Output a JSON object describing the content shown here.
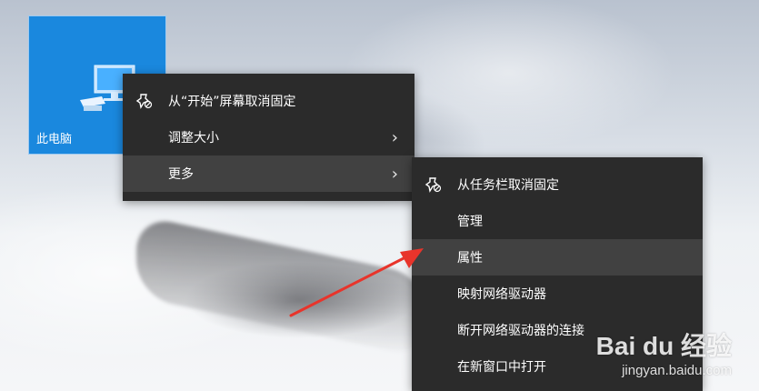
{
  "tile": {
    "label": "此电脑"
  },
  "main_menu": {
    "items": [
      {
        "label": "从“开始”屏幕取消固定",
        "icon": "unpin-icon"
      },
      {
        "label": "调整大小",
        "has_submenu": true
      },
      {
        "label": "更多",
        "has_submenu": true,
        "highlighted": true
      }
    ]
  },
  "sub_menu": {
    "items": [
      {
        "label": "从任务栏取消固定",
        "icon": "unpin-icon"
      },
      {
        "label": "管理"
      },
      {
        "label": "属性",
        "highlighted": true
      },
      {
        "label": "映射网络驱动器"
      },
      {
        "label": "断开网络驱动器的连接"
      },
      {
        "label": "在新窗口中打开"
      }
    ]
  },
  "watermark": {
    "brand": "Bai du 经验",
    "url": "jingyan.baidu.com"
  },
  "colors": {
    "tile": "#1a88de",
    "menu": "#2b2b2b",
    "highlight": "#414141",
    "arrow": "#e8342b"
  }
}
